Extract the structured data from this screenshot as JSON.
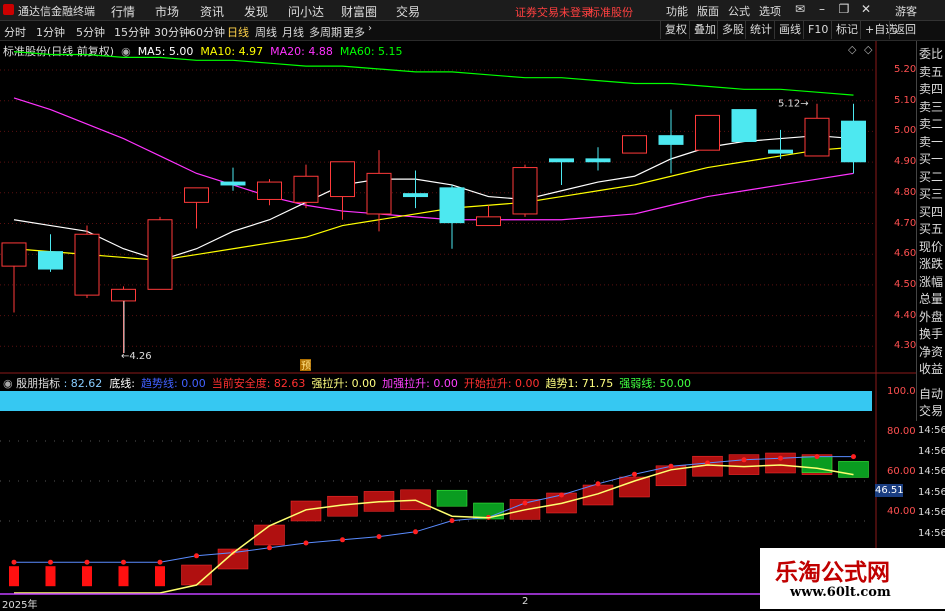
{
  "app": {
    "title": "通达信金融终端",
    "menus": [
      "行情",
      "市场",
      "资讯",
      "发现",
      "问小达",
      "财富圈",
      "交易"
    ],
    "notice": "证券交易未登录",
    "notice_stock": "标准股份",
    "right_menus": [
      "功能",
      "版面",
      "公式",
      "选项"
    ],
    "guest": "游客"
  },
  "periods": [
    "分时",
    "1分钟",
    "5分钟",
    "15分钟",
    "30分钟",
    "60分钟",
    "日线",
    "周线",
    "月线",
    "多周期",
    "更多"
  ],
  "active_period": "日线",
  "toolbar": [
    "复权",
    "叠加",
    "多股",
    "统计",
    "画线",
    "F10",
    "标记",
    "+自选",
    "返回"
  ],
  "info": {
    "stock": "标准股份(日线 前复权)",
    "ma5_label": "MA5: 5.00",
    "ma10_label": "MA10: 4.97",
    "ma20_label": "MA20: 4.88",
    "ma60_label": "MA60: 5.15",
    "colors": {
      "ma5": "#ffffff",
      "ma10": "#ffff00",
      "ma20": "#ff33ff",
      "ma60": "#00ff00"
    }
  },
  "price_axis": [
    "5.20",
    "5.10",
    "5.00",
    "4.90",
    "4.80",
    "4.70",
    "4.60",
    "4.50",
    "4.40",
    "4.30"
  ],
  "price_annotations": {
    "high": "5.12",
    "low": "4.26",
    "marker": "预"
  },
  "right_panel": [
    "委比",
    "卖五",
    "卖四",
    "卖三",
    "卖二",
    "卖一",
    "买一",
    "买二",
    "买三",
    "买四",
    "买五",
    "现价",
    "涨跌",
    "涨幅",
    "总量",
    "外盘",
    "换手",
    "净资",
    "收益"
  ],
  "right_panel_lower": [
    "自动",
    "交易"
  ],
  "indicator": {
    "name": "殷朋指标",
    "value": ": 82.62",
    "items": [
      {
        "label": "底线:",
        "color": "#ffffff"
      },
      {
        "label": "趋势线: 0.00",
        "color": "#4060ff"
      },
      {
        "label": "当前安全度: 82.63",
        "color": "#ff3030"
      },
      {
        "label": "强拉升: 0.00",
        "color": "#ffff80"
      },
      {
        "label": "加强拉升: 0.00",
        "color": "#ff40ff"
      },
      {
        "label": "开始拉升: 0.00",
        "color": "#ff3030"
      },
      {
        "label": "趋势1: 71.75",
        "color": "#ffff80"
      },
      {
        "label": "强弱线: 50.00",
        "color": "#40ff40"
      }
    ],
    "axis": [
      "100.0",
      "80.00",
      "60.00",
      "40.00"
    ],
    "current_value": "46.51",
    "time_labels": [
      "14:56",
      "14:56",
      "14:56",
      "14:56",
      "14:56",
      "14:56"
    ]
  },
  "date_labels": [
    "2025年",
    "2"
  ],
  "watermark": {
    "title": "乐淘公式网",
    "url": "www.60lt.com"
  },
  "chart_data": {
    "type": "candlestick",
    "candles": [
      {
        "o": 4.56,
        "c": 4.64,
        "h": 4.64,
        "l": 4.4
      },
      {
        "o": 4.61,
        "c": 4.55,
        "h": 4.67,
        "l": 4.54
      },
      {
        "o": 4.46,
        "c": 4.67,
        "h": 4.7,
        "l": 4.45
      },
      {
        "o": 4.44,
        "c": 4.48,
        "h": 4.49,
        "l": 4.26
      },
      {
        "o": 4.48,
        "c": 4.72,
        "h": 4.73,
        "l": 4.48
      },
      {
        "o": 4.78,
        "c": 4.83,
        "h": 4.83,
        "l": 4.69
      },
      {
        "o": 4.85,
        "c": 4.84,
        "h": 4.9,
        "l": 4.82
      },
      {
        "o": 4.79,
        "c": 4.85,
        "h": 4.86,
        "l": 4.77
      },
      {
        "o": 4.78,
        "c": 4.87,
        "h": 4.91,
        "l": 4.76
      },
      {
        "o": 4.8,
        "c": 4.92,
        "h": 4.92,
        "l": 4.72
      },
      {
        "o": 4.74,
        "c": 4.88,
        "h": 4.96,
        "l": 4.68
      },
      {
        "o": 4.81,
        "c": 4.8,
        "h": 4.89,
        "l": 4.76
      },
      {
        "o": 4.83,
        "c": 4.71,
        "h": 4.84,
        "l": 4.62
      },
      {
        "o": 4.7,
        "c": 4.73,
        "h": 4.77,
        "l": 4.7
      },
      {
        "o": 4.74,
        "c": 4.9,
        "h": 4.91,
        "l": 4.73
      },
      {
        "o": 4.93,
        "c": 4.92,
        "h": 4.93,
        "l": 4.84
      },
      {
        "o": 4.93,
        "c": 4.92,
        "h": 4.97,
        "l": 4.89
      },
      {
        "o": 4.95,
        "c": 5.01,
        "h": 5.01,
        "l": 4.95
      },
      {
        "o": 5.01,
        "c": 4.98,
        "h": 5.1,
        "l": 4.88
      },
      {
        "o": 4.96,
        "c": 5.08,
        "h": 5.08,
        "l": 4.96
      },
      {
        "o": 5.1,
        "c": 4.99,
        "h": 5.1,
        "l": 4.99
      },
      {
        "o": 4.96,
        "c": 4.95,
        "h": 5.03,
        "l": 4.93
      },
      {
        "o": 4.94,
        "c": 5.07,
        "h": 5.12,
        "l": 4.94
      },
      {
        "o": 5.06,
        "c": 4.92,
        "h": 5.12,
        "l": 4.88
      }
    ],
    "ma5": [
      4.72,
      4.7,
      4.68,
      4.62,
      4.58,
      4.62,
      4.68,
      4.72,
      4.78,
      4.84,
      4.86,
      4.86,
      4.84,
      4.8,
      4.79,
      4.82,
      4.85,
      4.87,
      4.93,
      4.97,
      4.99,
      5.0,
      5.01,
      5.0
    ],
    "ma10": [
      4.62,
      4.61,
      4.6,
      4.59,
      4.58,
      4.6,
      4.62,
      4.64,
      4.66,
      4.7,
      4.72,
      4.74,
      4.76,
      4.77,
      4.78,
      4.8,
      4.82,
      4.84,
      4.87,
      4.9,
      4.92,
      4.94,
      4.96,
      4.97
    ],
    "ma20": [
      5.14,
      5.1,
      5.05,
      5.0,
      4.94,
      4.88,
      4.84,
      4.8,
      4.77,
      4.75,
      4.74,
      4.73,
      4.72,
      4.72,
      4.72,
      4.72,
      4.73,
      4.74,
      4.77,
      4.8,
      4.82,
      4.84,
      4.86,
      4.88
    ],
    "ma60": [
      5.3,
      5.29,
      5.29,
      5.28,
      5.28,
      5.27,
      5.27,
      5.26,
      5.25,
      5.25,
      5.24,
      5.23,
      5.23,
      5.22,
      5.21,
      5.21,
      5.2,
      5.19,
      5.19,
      5.18,
      5.17,
      5.17,
      5.16,
      5.15
    ],
    "indicator_yellow": [
      0,
      0,
      0,
      0,
      0,
      5,
      25,
      42,
      52,
      55,
      57,
      58,
      48,
      47,
      52,
      56,
      62,
      70,
      77,
      80,
      79,
      80,
      78,
      74
    ],
    "indicator_blue": [
      18,
      18,
      18,
      18,
      18,
      22,
      24,
      27,
      30,
      32,
      34,
      37,
      44,
      46,
      55,
      60,
      67,
      73,
      78,
      80,
      82,
      83,
      84,
      84
    ],
    "indicator_bars_red": [
      8,
      8,
      8,
      8,
      8,
      10,
      20,
      35,
      50,
      53,
      56,
      57,
      0,
      0,
      51,
      55,
      60,
      65,
      72,
      78,
      79,
      80,
      79,
      0
    ],
    "indicator_bars_green": [
      0,
      0,
      0,
      0,
      0,
      0,
      0,
      0,
      0,
      0,
      0,
      0,
      58,
      50,
      0,
      0,
      0,
      0,
      0,
      0,
      0,
      0,
      79,
      76
    ],
    "ylim_price": [
      4.25,
      5.24
    ],
    "ylim_indicator": [
      0,
      100
    ]
  }
}
